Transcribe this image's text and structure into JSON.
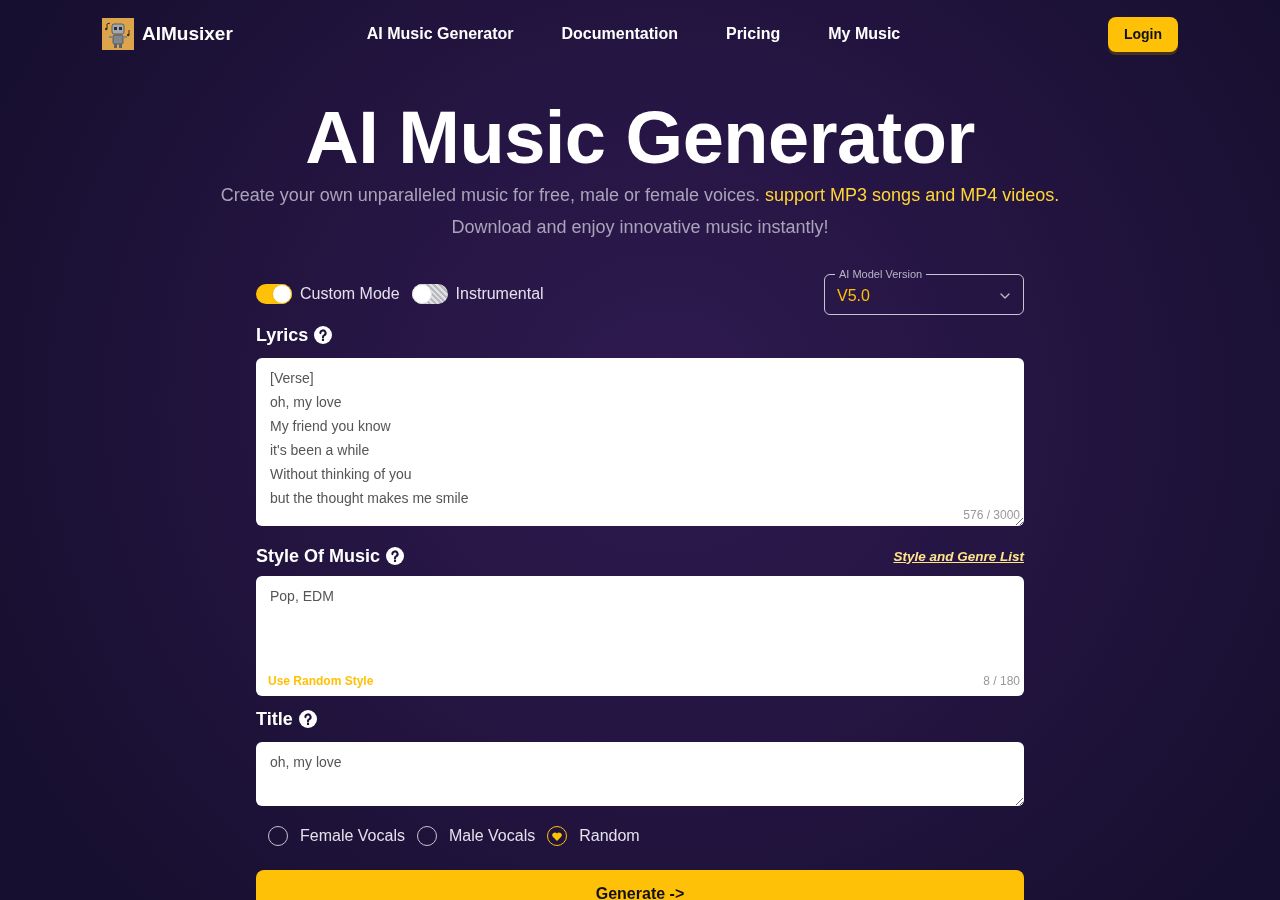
{
  "header": {
    "brand": "AIMusixer",
    "nav": [
      {
        "label": "AI Music Generator"
      },
      {
        "label": "Documentation"
      },
      {
        "label": "Pricing"
      },
      {
        "label": "My Music"
      }
    ],
    "login_button": "Login"
  },
  "hero": {
    "title": "AI Music Generator",
    "subtitle": "Create your own unparalleled music for free, male or female voices.",
    "highlight": "support MP3 songs and MP4 videos.",
    "subtitle_line_2": "Download and enjoy innovative music instantly!"
  },
  "form": {
    "toggles": [
      {
        "label": "Custom Mode",
        "on": true
      },
      {
        "label": "Instrumental",
        "on": false
      }
    ],
    "model_select": {
      "label": "AI Model Version",
      "value": "V5.0"
    },
    "lyrics": {
      "label": "Lyrics",
      "value": "[Verse]\noh, my love\nMy friend you know\nit's been a while\nWithout thinking of you\nbut the thought makes me smile",
      "counter": "576 / 3000"
    },
    "style": {
      "label": "Style Of Music",
      "link": "Style and Genre List",
      "value": "Pop, EDM",
      "random_button": "Use Random Style",
      "counter": "8 / 180"
    },
    "title": {
      "label": "Title",
      "value": "oh, my love"
    },
    "vocals": [
      {
        "label": "Female Vocals",
        "selected": false
      },
      {
        "label": "Male Vocals",
        "selected": false
      },
      {
        "label": "Random",
        "selected": true
      }
    ],
    "generate_button": "Generate ->"
  }
}
